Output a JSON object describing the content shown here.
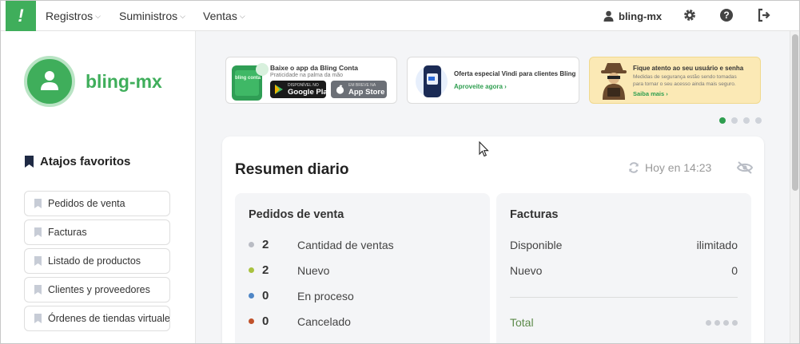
{
  "header": {
    "nav": [
      {
        "label": "Registros"
      },
      {
        "label": "Suministros"
      },
      {
        "label": "Ventas"
      }
    ],
    "user": "bling-mx",
    "icons": [
      "settings-icon",
      "help-icon",
      "logout-icon"
    ],
    "brand_color": "#3fae5b"
  },
  "sidebar": {
    "company": "bling-mx",
    "favorites_title": "Atajos favoritos",
    "favorites": [
      {
        "label": "Pedidos de venta"
      },
      {
        "label": "Facturas"
      },
      {
        "label": "Listado de productos"
      },
      {
        "label": "Clientes y proveedores"
      },
      {
        "label": "Órdenes de tiendas virtuales"
      }
    ]
  },
  "banners": [
    {
      "title": "Baixe o app da Bling Conta",
      "subtitle": "Praticidade na palma da mão",
      "app_label": "bling conta",
      "google_small": "DISPONÍVEL NO",
      "google_label": "Google Play",
      "apple_small": "EM BREVE NA",
      "apple_label": "App Store"
    },
    {
      "title": "Oferta especial Vindi para clientes Bling",
      "link": "Aproveite agora"
    },
    {
      "title": "Fique atento ao seu usuário e senha",
      "subtitle_1": "Medidas de segurança estão sendo tomadas",
      "subtitle_2": "para tornar o seu acesso ainda mais seguro.",
      "link": "Saiba mais"
    }
  ],
  "carousel": {
    "total": 4,
    "active": 0
  },
  "summary": {
    "title": "Resumen diario",
    "updated": "Hoy en 14:23",
    "orders": {
      "title": "Pedidos de venta",
      "rows": [
        {
          "count": "2",
          "label": "Cantidad de ventas",
          "color": "#b9bcc4"
        },
        {
          "count": "2",
          "label": "Nuevo",
          "color": "#a9c23f"
        },
        {
          "count": "0",
          "label": "En proceso",
          "color": "#4f86c6"
        },
        {
          "count": "0",
          "label": "Cancelado",
          "color": "#c0522b"
        }
      ]
    },
    "invoices": {
      "title": "Facturas",
      "available_label": "Disponible",
      "available_value": "ilimitado",
      "new_label": "Nuevo",
      "new_value": "0",
      "total_label": "Total"
    }
  }
}
